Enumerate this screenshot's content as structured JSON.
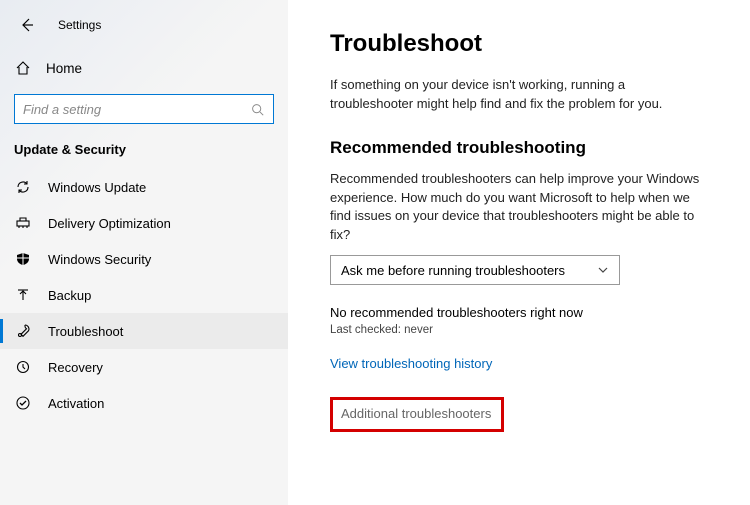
{
  "header": {
    "title": "Settings"
  },
  "home": {
    "label": "Home"
  },
  "search": {
    "placeholder": "Find a setting"
  },
  "section_header": "Update & Security",
  "nav": {
    "items": [
      {
        "id": "windows-update",
        "label": "Windows Update"
      },
      {
        "id": "delivery-optimization",
        "label": "Delivery Optimization"
      },
      {
        "id": "windows-security",
        "label": "Windows Security"
      },
      {
        "id": "backup",
        "label": "Backup"
      },
      {
        "id": "troubleshoot",
        "label": "Troubleshoot"
      },
      {
        "id": "recovery",
        "label": "Recovery"
      },
      {
        "id": "activation",
        "label": "Activation"
      }
    ]
  },
  "main": {
    "title": "Troubleshoot",
    "intro": "If something on your device isn't working, running a troubleshooter might help find and fix the problem for you.",
    "rec_heading": "Recommended troubleshooting",
    "rec_desc": "Recommended troubleshooters can help improve your Windows experience. How much do you want Microsoft to help when we find issues on your device that troubleshooters might be able to fix?",
    "dropdown_value": "Ask me before running troubleshooters",
    "no_rec": "No recommended troubleshooters right now",
    "last_checked": "Last checked: never",
    "history_link": "View troubleshooting history",
    "additional": "Additional troubleshooters"
  }
}
